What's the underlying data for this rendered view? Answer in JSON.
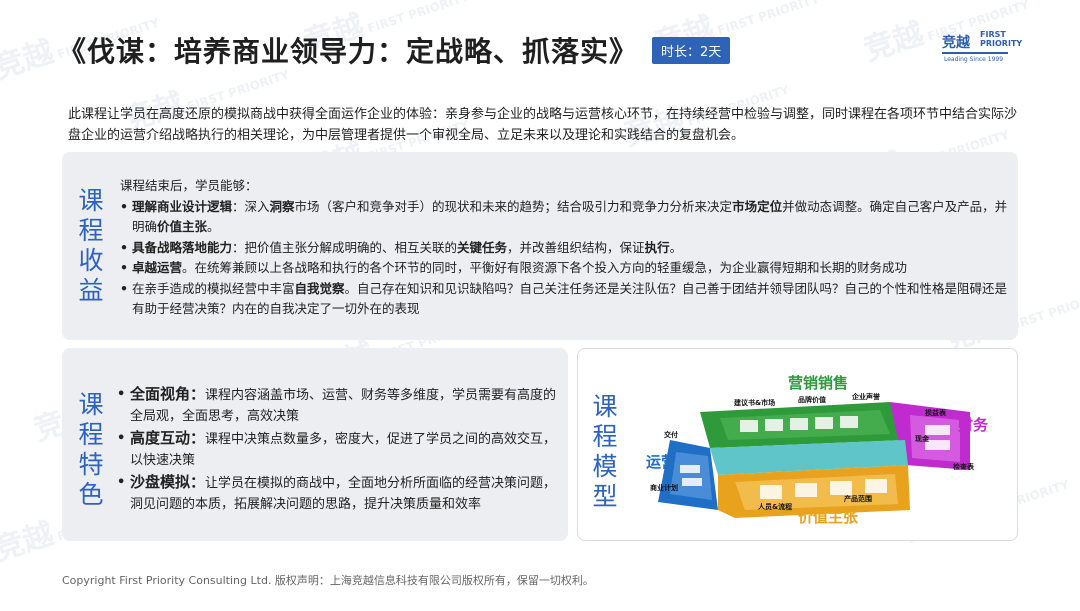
{
  "title": "《伐谋：培养商业领导力：定战略、抓落实》",
  "duration_badge": "时长：2天",
  "logo": {
    "cn": "竞越",
    "en_line1": "FIRST",
    "en_line2": "PRIORITY",
    "tagline": "Leading Since 1999"
  },
  "watermark": {
    "cn": "竞越",
    "en": "FIRST PRIORITY",
    "tag": "Leading Since 1999"
  },
  "intro": "此课程让学员在高度还原的模拟商战中获得全面运作企业的体验：亲身参与企业的战略与运营核心环节，在持续经营中检验与调整，同时课程在各项环节中结合实际沙盘企业的运营介绍战略执行的相关理论，为中层管理者提供一个审视全局、立足未来以及理论和实践结合的复盘机会。",
  "benefits": {
    "label_chars": [
      "课",
      "程",
      "收",
      "益"
    ],
    "lead": "课程结束后，学员能够：",
    "items": [
      {
        "p1": "理解商业设计逻辑",
        "p2": "：深入",
        "p3": "洞察",
        "p4": "市场（客户和竞争对手）的现状和未来的趋势；结合吸引力和竞争力分析来决定",
        "p5": "市场定位",
        "p6": "并做动态调整。确定自己客户及产品，并明确",
        "p7": "价值主张",
        "p8": "。"
      },
      {
        "p1": "具备战略落地能力",
        "p2": "：把价值主张分解成明确的、相互关联的",
        "p3": "关键任务",
        "p4": "，并改善组织结构，保证",
        "p5": "执行",
        "p6": "。"
      },
      {
        "p1": "卓越运营",
        "p2": "。在统筹兼顾以上各战略和执行的各个环节的同时，平衡好有限资源下各个投入方向的轻重缓急，为企业赢得短期和长期的财务成功"
      },
      {
        "p1": "在亲手造成的模拟经营中丰富",
        "p2": "自我觉察",
        "p3": "。自己存在知识和见识缺陷吗？自己关注任务还是关注队伍？自己善于团结并领导团队吗？自己的个性和性格是阻碍还是有助于经营决策？内在的自我决定了一切外在的表现"
      }
    ]
  },
  "features": {
    "label_chars": [
      "课",
      "程",
      "特",
      "色"
    ],
    "items": [
      {
        "head": "全面视角：",
        "text": "课程内容涵盖市场、运营、财务等多维度，学员需要有高度的全局观，全面思考，高效决策"
      },
      {
        "head": "高度互动：",
        "text": "课程中决策点数量多，密度大，促进了学员之间的高效交互，以快速决策"
      },
      {
        "head": "沙盘模拟：",
        "text": "让学员在模拟的商战中，全面地分析所面临的经营决策问题，洞见问题的本质，拓展解决问题的思路，提升决策质量和效率"
      }
    ]
  },
  "model": {
    "label_chars": [
      "课",
      "程",
      "模",
      "型"
    ],
    "big": {
      "marketing": "营销销售",
      "finance": "财务",
      "operations": "运营",
      "value": "价值主张"
    },
    "small": {
      "proposal": "建议书&市场",
      "brand": "品牌价值",
      "reputation": "企业声誉",
      "delivery": "交付",
      "loss": "损益表",
      "cash": "现金",
      "check": "检查表",
      "plan": "商业计划",
      "people": "人员&流程",
      "product": "产品范围"
    },
    "colors": {
      "marketing": "#2f9a3a",
      "finance": "#c02bd0",
      "operations": "#1f6fc6",
      "value": "#e8a21d"
    }
  },
  "footer": "Copyright First Priority Consulting Ltd.   版权声明：上海竞越信息科技有限公司版权所有，保留一切权利。"
}
